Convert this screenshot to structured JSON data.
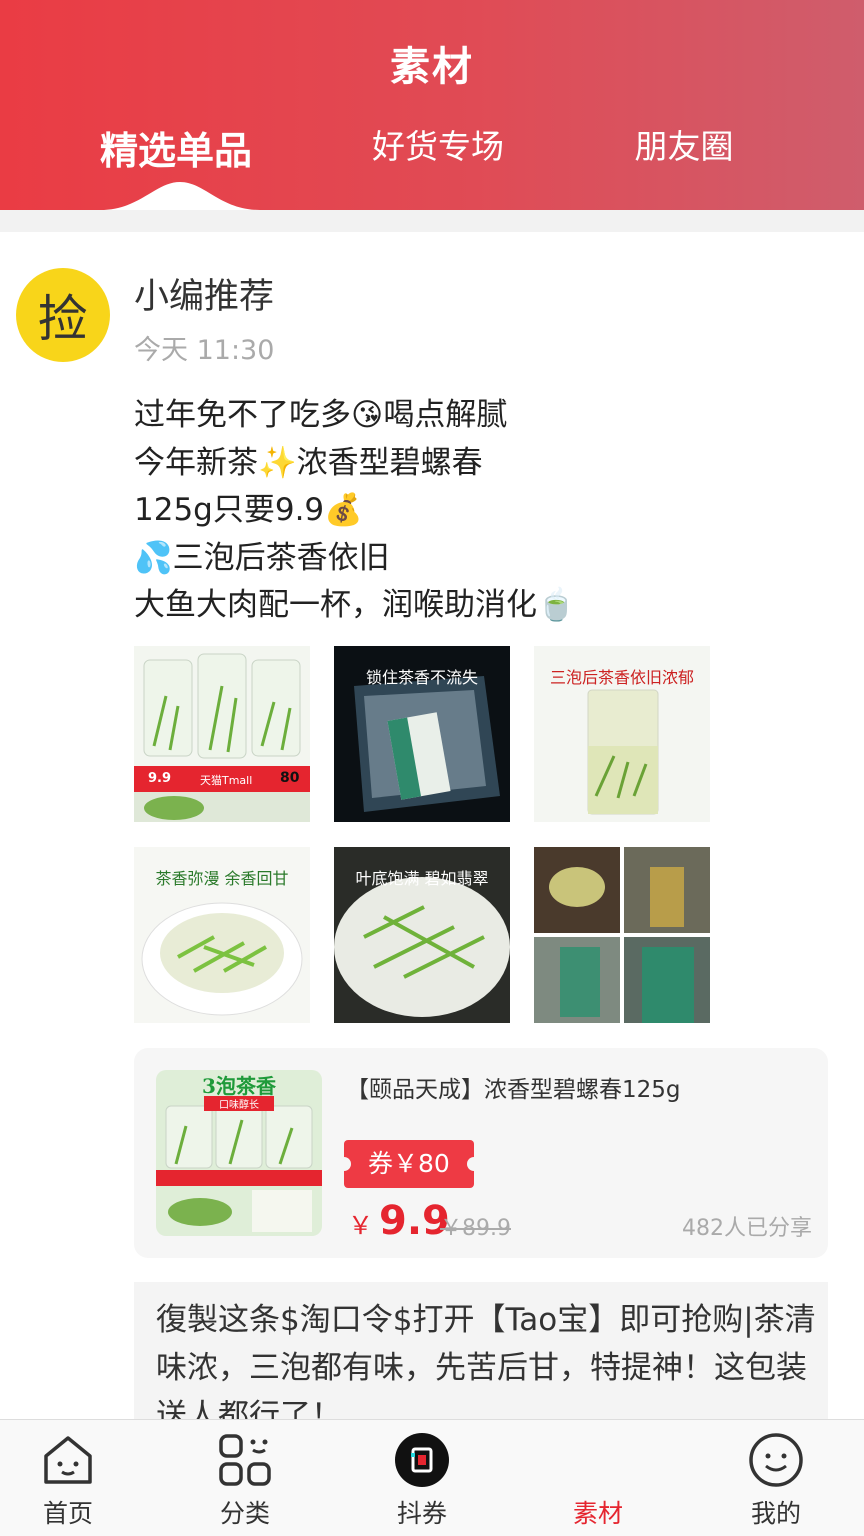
{
  "header": {
    "title": "素材",
    "tabs": [
      {
        "label": "精选单品",
        "active": true
      },
      {
        "label": "好货专场",
        "active": false
      },
      {
        "label": "朋友圈",
        "active": false
      }
    ]
  },
  "post": {
    "avatar_char": "捡",
    "author": "小编推荐",
    "time": "今天 11:30",
    "lines": [
      "过年免不了吃多😘喝点解腻",
      "今年新茶✨浓香型碧螺春",
      "125g只要9.9💰",
      "💦三泡后茶香依旧",
      "大鱼大肉配一杯，润喉助消化🍵"
    ],
    "images": [
      {
        "caption": "",
        "price_label": "9.9",
        "store_label": "天猫Tmall",
        "coupon_label": "80"
      },
      {
        "caption": "锁住茶香不流失"
      },
      {
        "caption": "三泡后茶香依旧浓郁"
      },
      {
        "caption": "茶香弥漫 余香回甘"
      },
      {
        "caption": "叶底饱满 碧如翡翠"
      },
      {
        "caption": ""
      }
    ]
  },
  "product": {
    "thumb_banner": "3泡茶香",
    "thumb_sub": "口味醇长",
    "title": "【颐品天成】浓香型碧螺春125g",
    "coupon": "券￥80",
    "currency": "￥",
    "price": "9.9",
    "original_price": "￥89.9",
    "shares": "482人已分享"
  },
  "copy_text": "復製这条$淘口令$打开【Tao宝】即可抢购|茶清味浓，三泡都有味，先苦后甘，特提神！这包装送人都行了！",
  "nav": [
    {
      "label": "首页",
      "icon": "home-icon",
      "active": false
    },
    {
      "label": "分类",
      "icon": "category-icon",
      "active": false
    },
    {
      "label": "抖券",
      "icon": "douyin-icon",
      "active": false
    },
    {
      "label": "素材",
      "icon": "material-icon",
      "active": true
    },
    {
      "label": "我的",
      "icon": "profile-icon",
      "active": false
    }
  ],
  "colors": {
    "accent": "#e5252f",
    "header_start": "#ea3c44",
    "header_end": "#cf5d6c",
    "avatar_bg": "#f8d51a"
  }
}
